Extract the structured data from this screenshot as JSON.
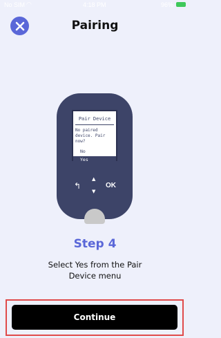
{
  "status_bar": {
    "carrier": "No SIM",
    "time": "4:18 PM",
    "battery": "96%"
  },
  "header": {
    "title": "Pairing",
    "close_icon": "close-icon"
  },
  "device": {
    "screen_title": "Pair Device",
    "screen_message": "No paired device. Pair now?",
    "option_no": "No",
    "option_yes": "Yes",
    "ok_label": "OK",
    "back_icon": "back-arrow-icon",
    "up_icon": "up-triangle-icon",
    "down_icon": "down-triangle-icon"
  },
  "step": {
    "title": "Step 4",
    "description": "Select Yes from the Pair Device menu"
  },
  "footer": {
    "continue_label": "Continue"
  },
  "colors": {
    "accent": "#5a67d8",
    "device_body": "#3d4468",
    "background": "#eef0fb",
    "highlight_frame": "#e04a4a"
  }
}
